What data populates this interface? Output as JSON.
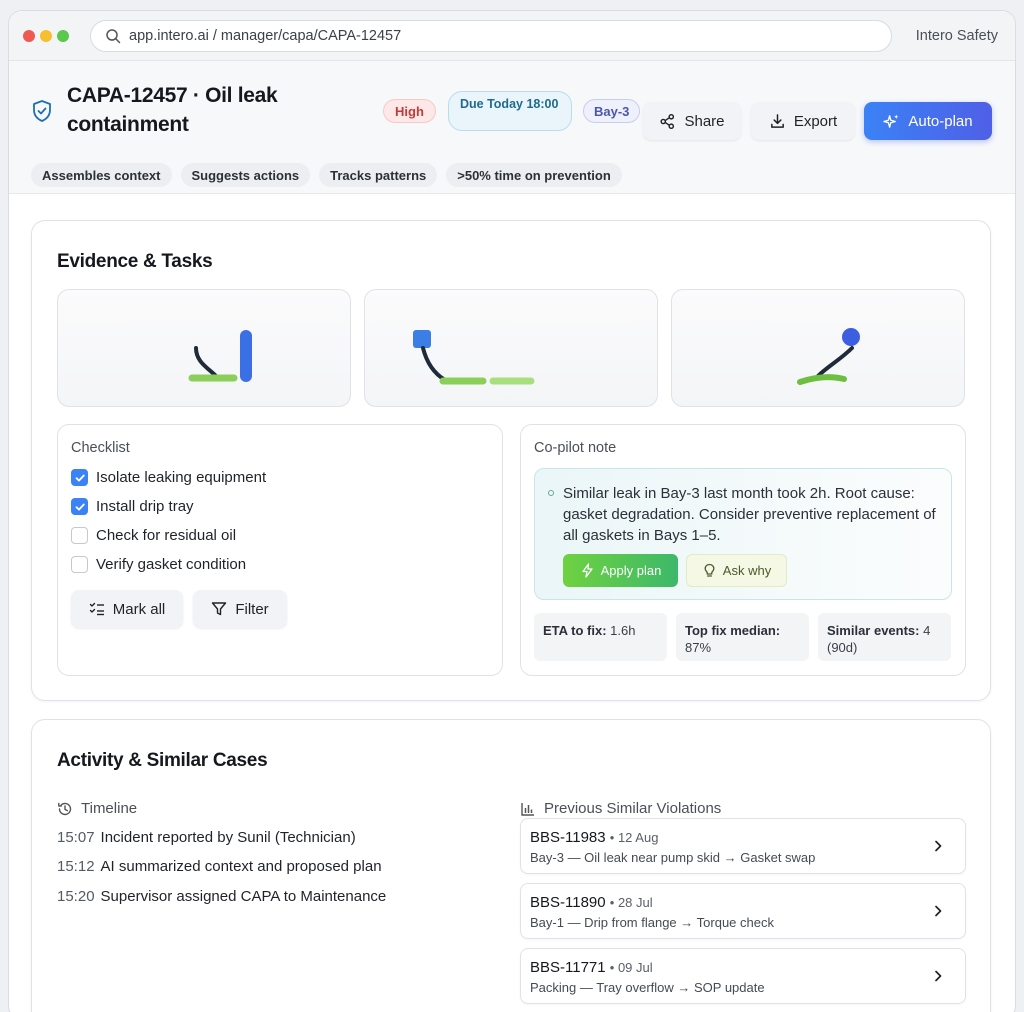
{
  "browser": {
    "url": "app.intero.ai / manager/capa/CAPA-12457",
    "brand": "Intero Safety"
  },
  "header": {
    "title": "CAPA-12457 · Oil leak containment",
    "badges": {
      "priority": "High",
      "due": "Due Today 18:00",
      "location": "Bay-3"
    },
    "actions": {
      "share": "Share",
      "export": "Export",
      "auto_plan": "Auto-plan"
    },
    "chips": [
      "Assembles context",
      "Suggests actions",
      "Tracks patterns",
      ">50% time on prevention"
    ]
  },
  "evidence_tasks": {
    "title": "Evidence & Tasks",
    "checklist": {
      "label": "Checklist",
      "items": [
        {
          "label": "Isolate leaking equipment",
          "checked": true
        },
        {
          "label": "Install drip tray",
          "checked": true
        },
        {
          "label": "Check for residual oil",
          "checked": false
        },
        {
          "label": "Verify gasket condition",
          "checked": false
        }
      ],
      "mark_all": "Mark all",
      "filter": "Filter"
    },
    "copilot": {
      "label": "Co-pilot note",
      "note": "Similar leak in Bay-3 last month took 2h. Root cause: gasket degradation. Consider preventive replacement of all gaskets in Bays 1–5.",
      "apply": "Apply plan",
      "ask": "Ask why",
      "stats": [
        {
          "label": "ETA to fix:",
          "value": "1.6h"
        },
        {
          "label": "Top fix median:",
          "value": "87%"
        },
        {
          "label": "Similar events:",
          "value": "4 (90d)"
        }
      ]
    }
  },
  "activity": {
    "title": "Activity & Similar Cases",
    "timeline_label": "Timeline",
    "timeline": [
      {
        "time": "15:07",
        "text": "Incident reported by Sunil (Technician)"
      },
      {
        "time": "15:12",
        "text": "AI summarized context and proposed plan"
      },
      {
        "time": "15:20",
        "text": "Supervisor assigned CAPA to Maintenance"
      }
    ],
    "similar_label": "Previous Similar Violations",
    "cases": [
      {
        "id": "BBS-11983",
        "date": "• 12 Aug",
        "desc": "Bay-3 — Oil leak near pump skid → Gasket swap"
      },
      {
        "id": "BBS-11890",
        "date": "• 28 Jul",
        "desc": "Bay-1 — Drip from flange → Torque check"
      },
      {
        "id": "BBS-11771",
        "date": "• 09 Jul",
        "desc": "Packing — Tray overflow → SOP update"
      }
    ]
  },
  "colors": {
    "accent": "#3b82f6",
    "danger": "#c23b3b",
    "success": "#3db86a"
  }
}
